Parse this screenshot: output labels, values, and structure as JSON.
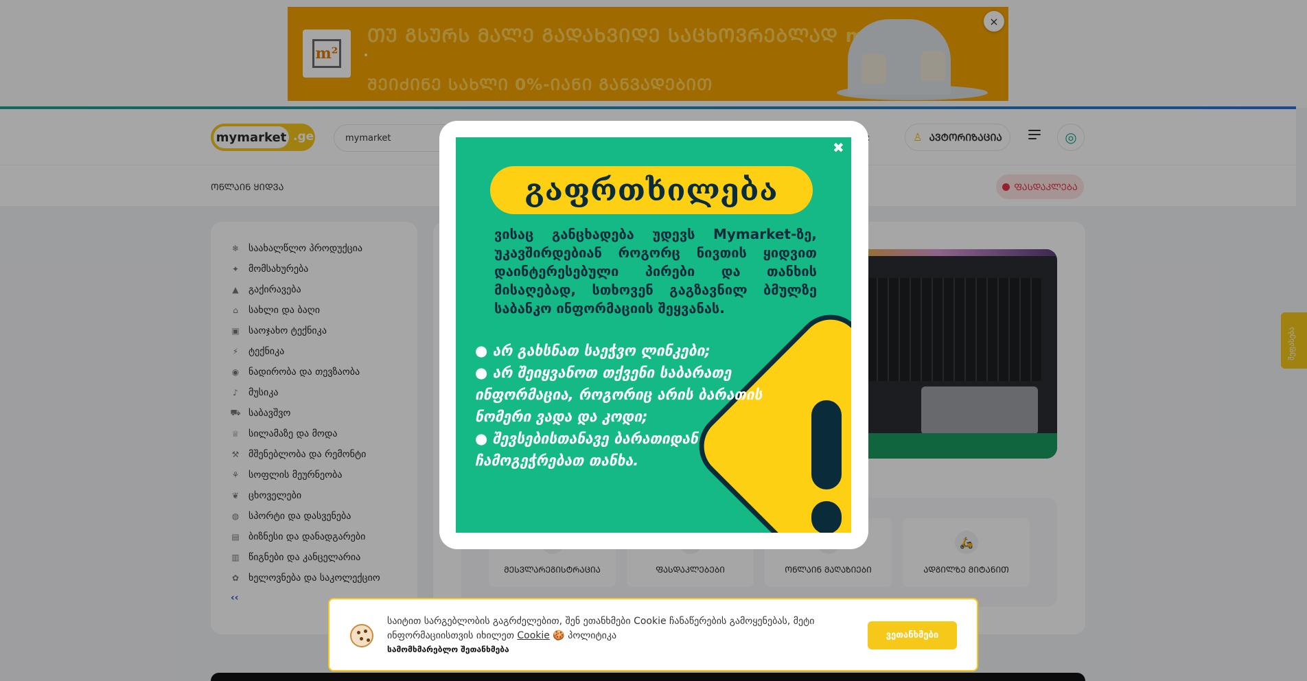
{
  "ad_banner": {
    "headline": "ᲗᲣ ᲒᲡᲣᲠᲡ ᲛᲐᲚᲔ ᲒᲐᲓᲐᲮᲕᲘᲓᲔ ᲡᲐᲪᲮᲝᲕᲠᲔᲑᲚᲐᲓ m²-ᲨᲘ",
    "subline": "ᲨᲔᲘᲫᲘᲜᲔ ᲡᲐᲮᲚᲘ 0%-ᲘᲐᲜᲘ ᲒᲐᲜᲕᲐᲓᲔᲑᲘᲗ",
    "logo_text": "m²",
    "close_icon": "×",
    "bg_color": "#f5a300"
  },
  "header": {
    "logo_main": "mymarket",
    "logo_suffix": ".ge",
    "search_value": "mymarket",
    "cart_icon": "⇄",
    "auth_icon": "♙",
    "auth_label": "ᲐᲕᲢᲝᲠᲘᲖᲐᲪᲘᲐ",
    "fingerprint_icon": "◎"
  },
  "subheader": {
    "online_shop": "ᲝᲜᲚᲐᲘᲜ ᲧᲘᲓᲕᲐ",
    "discounts": "ᲤᲐᲡᲓᲐᲙᲚᲔᲑᲐ"
  },
  "sidebar": {
    "categories": [
      {
        "label": "საახალწლო პროდუქცია",
        "icon": "❄"
      },
      {
        "label": "მომსახურება",
        "icon": "✦"
      },
      {
        "label": "გაქირავება",
        "icon": "▲"
      },
      {
        "label": "სახლი და ბაღი",
        "icon": "⌂"
      },
      {
        "label": "საოჯახო ტექნიკა",
        "icon": "▣"
      },
      {
        "label": "ტექნიკა",
        "icon": "⚡"
      },
      {
        "label": "ნადირობა და თევზაობა",
        "icon": "◉"
      },
      {
        "label": "მუსიკა",
        "icon": "♪"
      },
      {
        "label": "საბავშვო",
        "icon": "⛟"
      },
      {
        "label": "სილამაზე და მოდა",
        "icon": "♕"
      },
      {
        "label": "მშენებლობა და რემონტი",
        "icon": "⚒"
      },
      {
        "label": "სოფლის მეურნეობა",
        "icon": "⚘"
      },
      {
        "label": "ცხოველები",
        "icon": "❦"
      },
      {
        "label": "სპორტი და დასვენება",
        "icon": "◍"
      },
      {
        "label": "ბიზნესი და დანადგარები",
        "icon": "▤"
      },
      {
        "label": "წიგნები და კანცელარია",
        "icon": "▥"
      },
      {
        "label": "ხელოვნება და საკოლექციო",
        "icon": "✿"
      }
    ],
    "collapse_icon": "‹‹"
  },
  "quick_links": [
    {
      "label": "ᲛᲔᲡᲕᲚᲐᲠᲔᲒᲘᲡᲢᲠᲐᲪᲘᲐ",
      "icon": ""
    },
    {
      "label": "ᲤᲐᲡᲓᲐᲙᲚᲔᲑᲔᲑᲘ",
      "icon": ""
    },
    {
      "label": "ᲝᲜᲚᲐᲘᲜ ᲛᲐᲦᲐᲖᲘᲔᲑᲘ",
      "icon": ""
    },
    {
      "label": "ᲐᲓᲒᲘᲚᲖᲔ ᲛᲘᲢᲐᲜᲘᲗ",
      "icon": "🛵"
    }
  ],
  "feedback_tab": "შეფასება",
  "modal": {
    "title": "გაფრთხილება",
    "paragraph": "ვისაც განცხადება უდევს Mymarket-ზე, უკავშირდებიან როგორც ნივთის ყიდვით დაინტერესებული პირები და თანხის მისაღებად, სთხოვენ გაგზავნილ ბმულზე საბანკო ინფორმაციის შეყვანას.",
    "bullets": [
      "● არ გახსნათ საეჭვო ლინკები;",
      "● არ შეიყვანოთ თქვენი საბარათე ინფორმაცია, როგორიც არის ბარათის ნომერი ვადა და კოდი;",
      "● შევსებისთანავე ბარათიდან ჩამოგეჭრებათ თანხა."
    ],
    "close_icon": "✖"
  },
  "cookie": {
    "text_before": "საიტით სარგებლობის გაგრძელებით, შენ ეთანხმები Cookie ჩანაწერების გამოყენებას, მეტი ინფორმაციისთვის იხილეთ",
    "link": "Cookie",
    "text_after": "🍪 პოლიტიკა",
    "manage": "სამომხმარებლო შეთანხმება",
    "accept": "ვეთანხმები"
  }
}
